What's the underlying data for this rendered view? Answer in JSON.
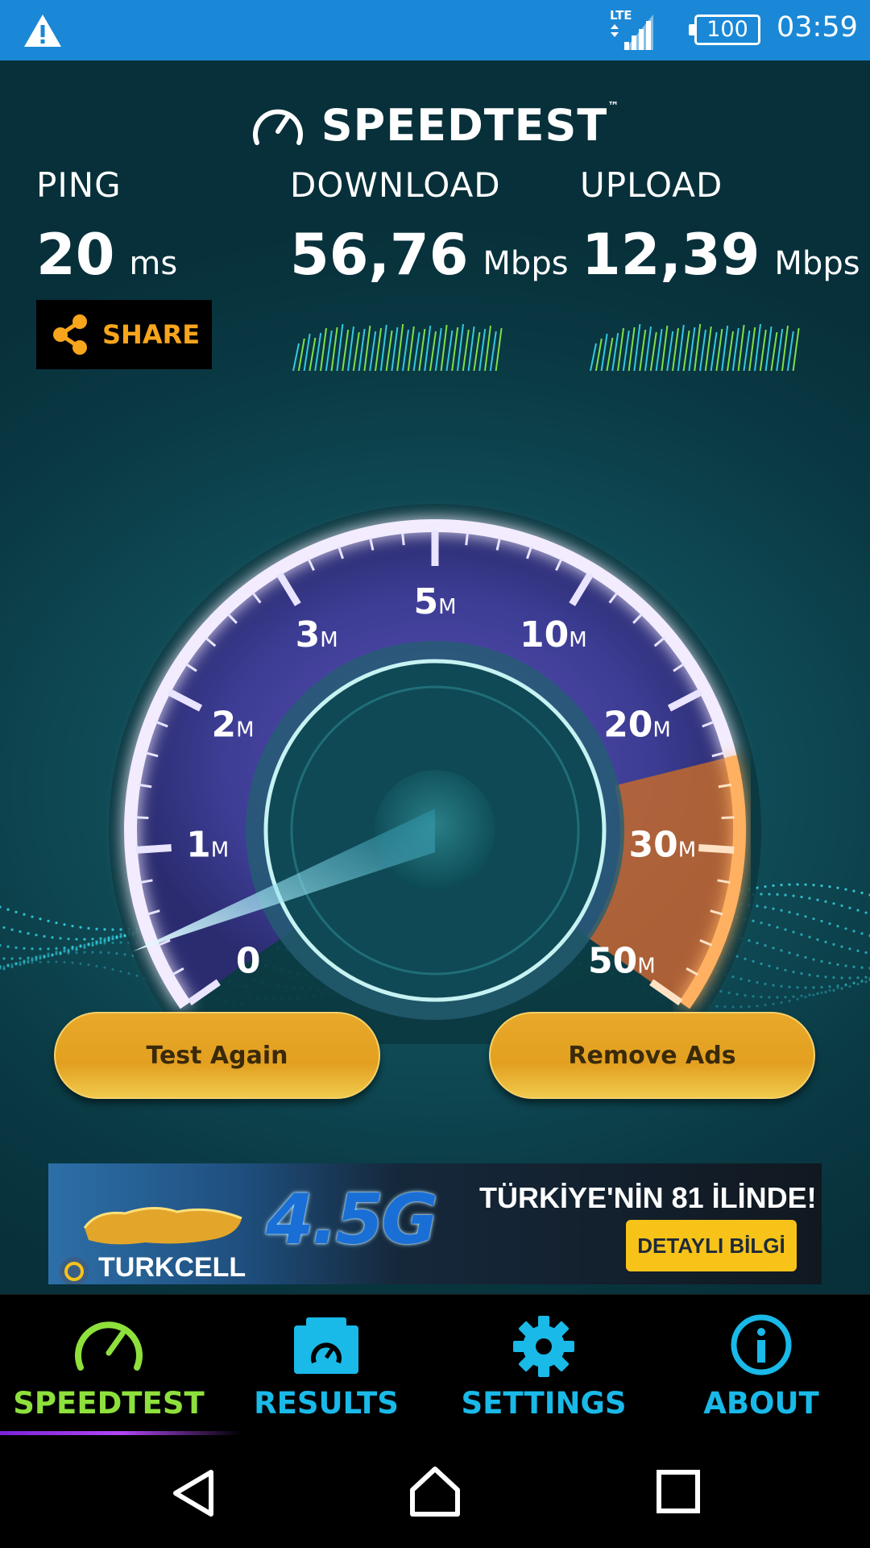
{
  "status_bar": {
    "network": "LTE",
    "battery": "100",
    "time": "03:59"
  },
  "app": {
    "title": "SPEEDTEST",
    "trademark": "™"
  },
  "results": {
    "ping": {
      "label": "PING",
      "value": "20",
      "unit": "ms"
    },
    "download": {
      "label": "DOWNLOAD",
      "value": "56,76",
      "unit": "Mbps"
    },
    "upload": {
      "label": "UPLOAD",
      "value": "12,39",
      "unit": "Mbps"
    }
  },
  "share_label": "SHARE",
  "gauge": {
    "ticks": [
      {
        "num": "0",
        "unit": ""
      },
      {
        "num": "1",
        "unit": "M"
      },
      {
        "num": "2",
        "unit": "M"
      },
      {
        "num": "3",
        "unit": "M"
      },
      {
        "num": "5",
        "unit": "M"
      },
      {
        "num": "10",
        "unit": "M"
      },
      {
        "num": "20",
        "unit": "M"
      },
      {
        "num": "30",
        "unit": "M"
      },
      {
        "num": "50",
        "unit": "M"
      }
    ],
    "needle_value": "0"
  },
  "buttons": {
    "test_again": "Test Again",
    "remove_ads": "Remove Ads"
  },
  "ad": {
    "tagline": "4.5G",
    "headline": "TÜRKİYE'NİN 81 İLİNDE!",
    "cta": "DETAYLI BİLGİ",
    "brand": "TURKCELL"
  },
  "nav": [
    {
      "label": "SPEEDTEST",
      "icon": "speedometer-icon",
      "active": true
    },
    {
      "label": "RESULTS",
      "icon": "folder-gauge-icon",
      "active": false
    },
    {
      "label": "SETTINGS",
      "icon": "gear-icon",
      "active": false
    },
    {
      "label": "ABOUT",
      "icon": "info-icon",
      "active": false
    }
  ],
  "colors": {
    "status_bar": "#1a88d6",
    "accent_green": "#8ee03c",
    "accent_blue": "#19b9e8",
    "button_gold": "#e3a020",
    "share_orange": "#f7a51c"
  }
}
